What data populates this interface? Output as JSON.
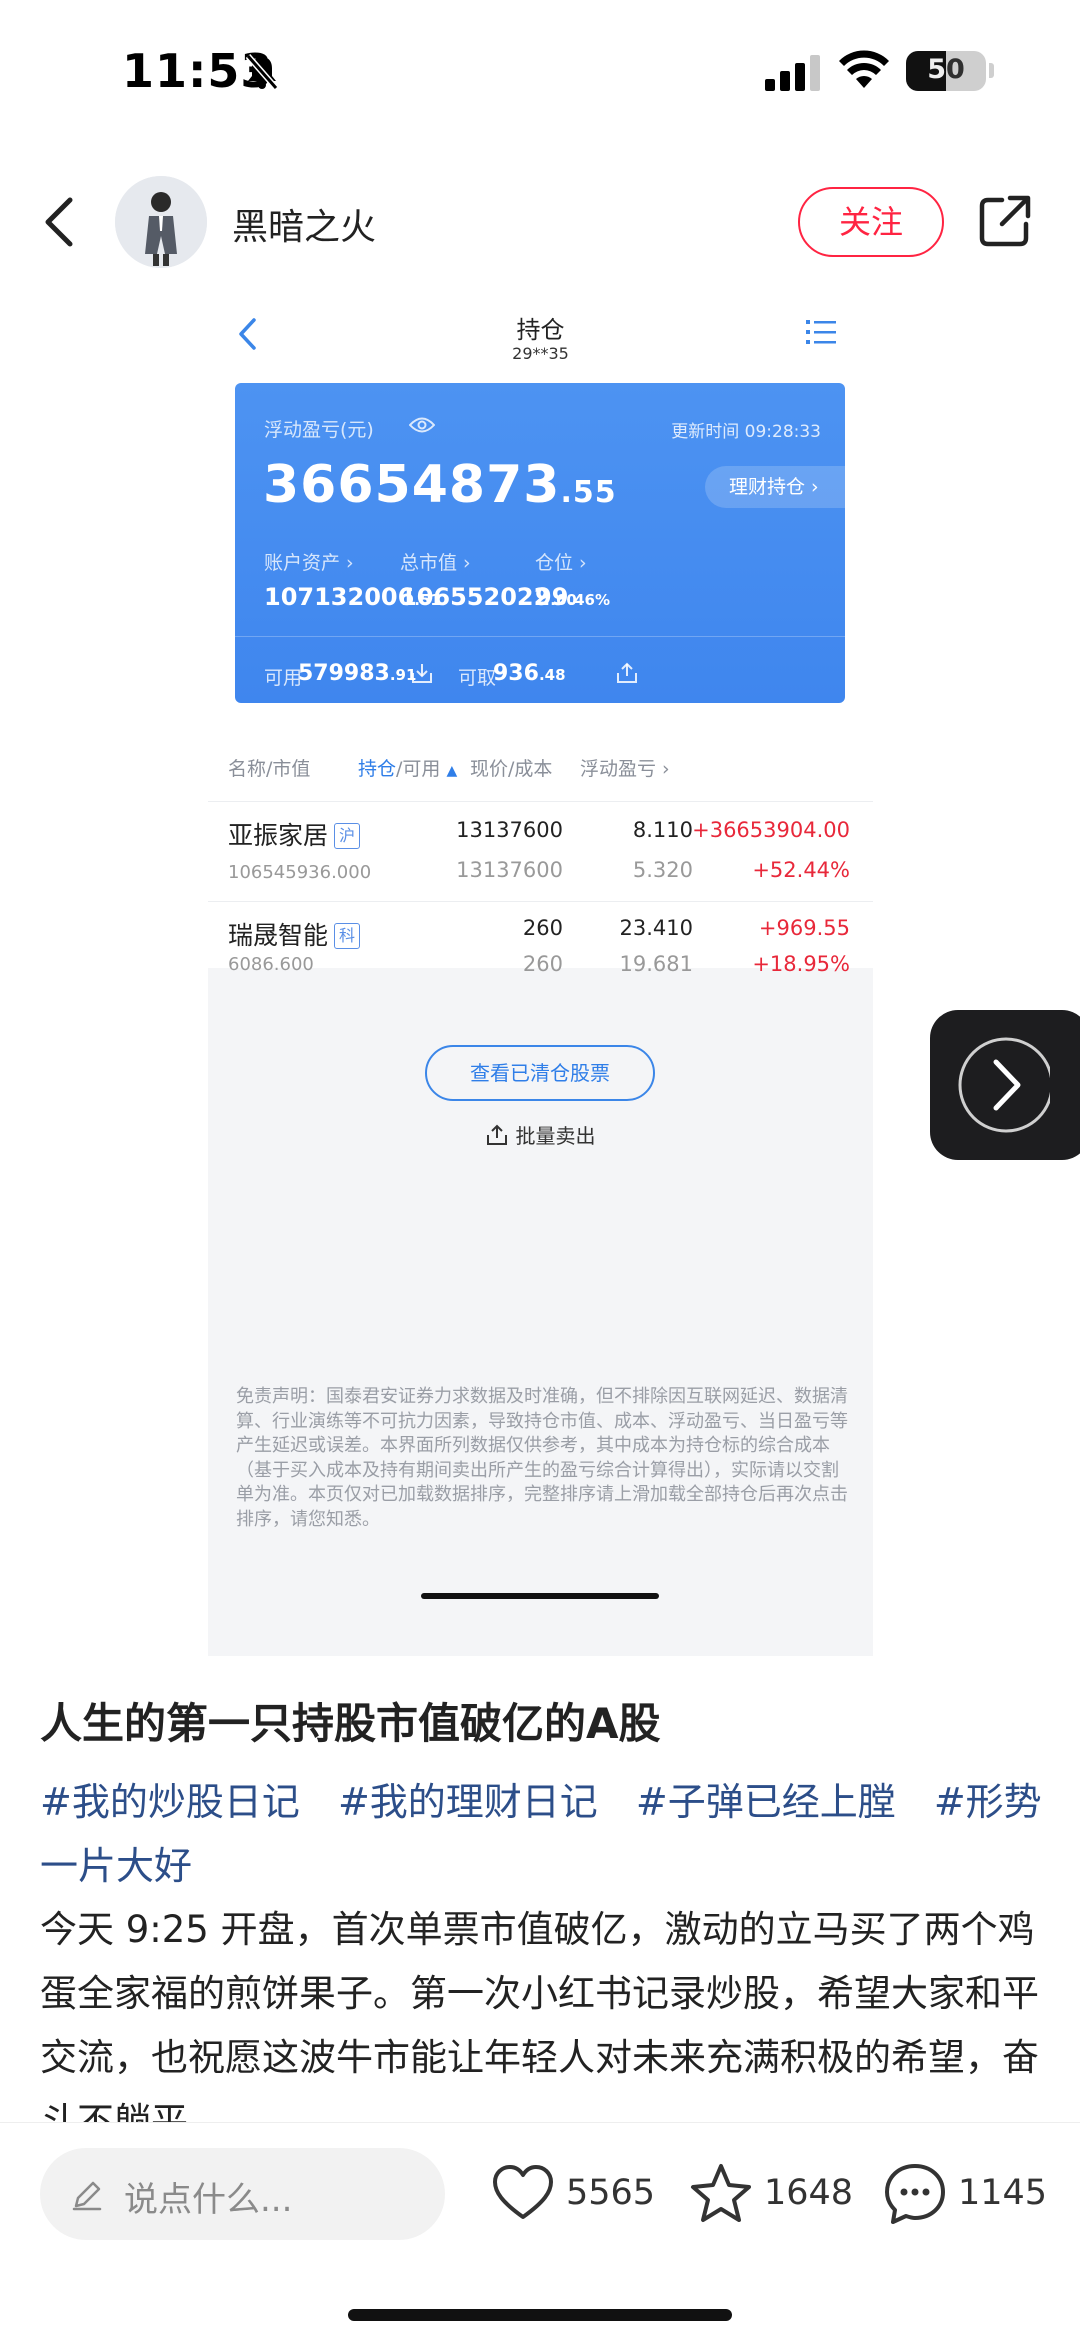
{
  "status_bar": {
    "time": "11:53",
    "battery": "50"
  },
  "header": {
    "author_name": "黑暗之火",
    "follow_label": "关注"
  },
  "embedded_screenshot": {
    "title": "持仓",
    "account": "29**35",
    "card": {
      "pnl_label": "浮动盈亏(元)",
      "update_time": "更新时间 09:28:33",
      "pnl_int": "36654873",
      "pnl_dec": ".55",
      "wealth_pill": "理财持仓",
      "metrics": [
        {
          "label": "账户资产",
          "int": "107132006",
          "dec": ".51"
        },
        {
          "label": "总市值",
          "int": "106552022",
          "dec": ".60"
        },
        {
          "label": "仓位",
          "int": "99",
          "dec": ".46%"
        }
      ],
      "available_label": "可用",
      "available_int": "579983",
      "available_dec": ".91",
      "withdraw_label": "可取",
      "withdraw_int": "936",
      "withdraw_dec": ".48"
    },
    "table": {
      "headers": {
        "name": "名称/市值",
        "hold_a": "持仓",
        "hold_b": "/可用",
        "price": "现价/成本",
        "pnl": "浮动盈亏"
      },
      "rows": [
        {
          "name": "亚振家居",
          "tag": "沪",
          "market_value": "106545936.000",
          "holding": "13137600",
          "available": "13137600",
          "price": "8.110",
          "cost": "5.320",
          "pnl": "+36653904.00",
          "pnl_pct": "+52.44%"
        },
        {
          "name": "瑞晟智能",
          "tag": "科",
          "market_value": "6086.600",
          "holding": "260",
          "available": "260",
          "price": "23.410",
          "cost": "19.681",
          "pnl": "+969.55",
          "pnl_pct": "+18.95%"
        }
      ]
    },
    "cleared_button": "查看已清仓股票",
    "batch_sell": "批量卖出",
    "disclaimer": "免责声明：国泰君安证券力求数据及时准确，但不排除因互联网延迟、数据清算、行业演练等不可抗力因素，导致持仓市值、成本、浮动盈亏、当日盈亏等产生延迟或误差。本界面所列数据仅供参考，其中成本为持仓标的综合成本（基于买入成本及持有期间卖出所产生的盈亏综合计算得出），实际请以交割单为准。本页仅对已加载数据排序，完整排序请上滑加载全部持仓后再次点击排序，请您知悉。"
  },
  "post": {
    "title": "人生的第一只持股市值破亿的A股",
    "tags": [
      "#我的炒股日记",
      "#我的理财日记",
      "#子弹已经上膛",
      "#形势一片大好"
    ],
    "body": "今天 9:25 开盘，首次单票市值破亿，激动的立马买了两个鸡蛋全家福的煎饼果子。第一次小红书记录炒股，希望大家和平交流，也祝愿这波牛市能让年轻人对未来充满积极的希望，奋斗不躺平"
  },
  "bottom_bar": {
    "comment_placeholder": "说点什么...",
    "likes": "5565",
    "collects": "1648",
    "comments": "1145"
  },
  "colors": {
    "brand_red": "#ff2442",
    "card_blue": "#4d93f2",
    "gain_red": "#e8283a",
    "tag_blue": "#2c4e89"
  }
}
